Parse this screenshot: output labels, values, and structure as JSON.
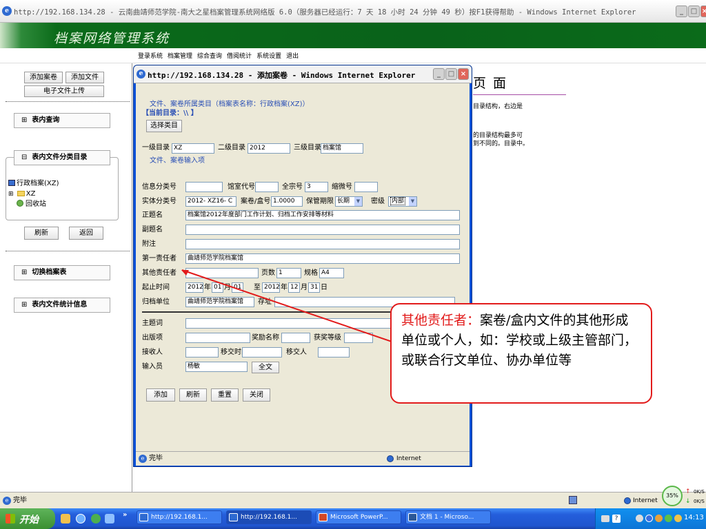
{
  "browser": {
    "title": "http://192.168.134.28 - 云南曲靖师范学院-南大之星档案管理系统网络版 6.0（服务器已经运行：7 天 18 小时 24 分钟 49 秒）按F1获得帮助 - Windows Internet Explorer",
    "status_text": "完毕",
    "zone_text": "Internet",
    "zoom_text": "35%",
    "net_up": "0K/S",
    "net_down": "0K/S"
  },
  "app": {
    "banner_title": "档案网络管理系统",
    "menu": [
      "登录系统",
      "档案管理",
      "综合查询",
      "借阅统计",
      "系统设置",
      "退出"
    ]
  },
  "sidebar": {
    "add_volume": "添加案卷",
    "add_file": "添加文件",
    "e_upload": "电子文件上传",
    "section_query": "表内查询",
    "section_catalog": "表内文件分类目录",
    "tree_root": "行政档案(XZ)",
    "tree_child": "XZ",
    "tree_recycle": "回收站",
    "refresh": "刷新",
    "back": "返回",
    "section_switch": "切换档案表",
    "section_stats": "表内文件统计信息",
    "expand_sign": "⊞",
    "collapse_sign": "⊟"
  },
  "bg_page": {
    "title": "页 面",
    "line1": "目录结构，右边是",
    "line2": "的目录结构最多可",
    "line3": "到不同的。目录中。"
  },
  "popup": {
    "title": "http://192.168.134.28 - 添加案卷 - Windows Internet Explorer",
    "type_line": "文件、案卷所属类目（档案表名称：行政档案(XZ)）",
    "current_dir": "【当前目录：\\\\ 】",
    "select_category": "选择类目",
    "level1_label": "一级目录",
    "level1_value": "XZ",
    "level2_label": "二级目录",
    "level2_value": "2012",
    "level3_label": "三级目录",
    "level3_value": "档案馆",
    "input_section": "文件、案卷输入项",
    "info_class_label": "信息分类号",
    "archive_code_label": "馆室代号",
    "fonds_label": "全宗号",
    "fonds_value": "3",
    "microfilm_label": "缩微号",
    "entity_class_label": "实体分类号",
    "entity_class_value": "2012- XZ16- C",
    "volume_no_label": "案卷/盒号",
    "volume_no_value": "1.0000",
    "retention_label": "保管期限",
    "retention_value": "长期",
    "secrecy_label": "密级",
    "secrecy_value": "内部",
    "main_title_label": "正题名",
    "main_title_value": "档案馆2012年度部门工作计划、归档工作安排等材料",
    "sub_title_label": "副题名",
    "note_label": "附注",
    "first_resp_label": "第一责任者",
    "first_resp_value": "曲靖师范学院档案馆",
    "other_resp_label": "其他责任者",
    "pages_label": "页数",
    "pages_value": "1",
    "spec_label": "规格",
    "spec_value": "A4",
    "period_label": "起止时间",
    "start_year": "2012",
    "start_month": "01",
    "start_day": "01",
    "end_year": "2012",
    "end_month": "12",
    "end_day": "31",
    "year_char": "年",
    "month_char": "月",
    "day_char": "日",
    "to_char": "至",
    "archive_unit_label": "归档单位",
    "archive_unit_value": "曲靖师范学院档案馆",
    "storage_label": "存址",
    "subject_label": "主题词",
    "issue_label": "出版项",
    "award_label": "奖励名称",
    "award_level_label": "获奖等级",
    "receiver_label": "接收人",
    "transfer_time_label": "移交时间",
    "transferor_label": "移交人",
    "entry_label": "输入员",
    "entry_value": "杨敏",
    "fulltext_button": "全文",
    "actions": [
      "添加",
      "刷新",
      "重置",
      "关闭"
    ],
    "status_text": "完毕",
    "zone_text": "Internet"
  },
  "callout": {
    "label": "其他责任者：",
    "text": "案卷/盒内文件的其他形成单位或个人，如：学校或上级主管部门，或联合行文单位、协办单位等"
  },
  "taskbar": {
    "start": "开始",
    "tasks": [
      "http://192.168.1...",
      "http://192.168.1...",
      "Microsoft PowerP...",
      "文档 1 - Microso..."
    ],
    "clock": "14:13"
  },
  "colors": {
    "xp_blue": "#0a52d9",
    "banner_green": "#0b6b1a",
    "callout_red": "#e21b1b",
    "field_blue": "#2a4fb5"
  }
}
